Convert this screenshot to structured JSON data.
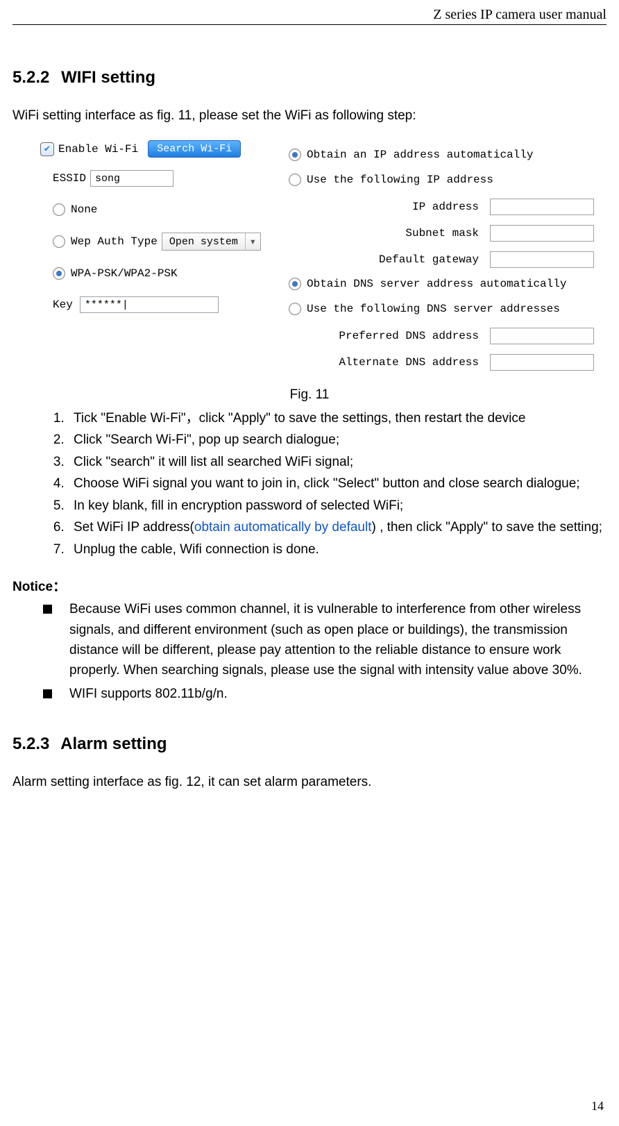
{
  "header": {
    "title": "Z series IP camera user manual"
  },
  "page_number": "14",
  "section1": {
    "number": "5.2.2",
    "title": "WIFI setting",
    "intro": "WiFi setting interface as fig. 11, please set the WiFi as following step:"
  },
  "wifi_panel": {
    "enable_label": "Enable Wi-Fi",
    "search_btn": "Search Wi-Fi",
    "essid_label": "ESSID",
    "essid_value": "song",
    "auth_none": "None",
    "auth_wep": "Wep Auth Type",
    "wep_select_value": "Open system",
    "auth_wpa": "WPA-PSK/WPA2-PSK",
    "key_label": "Key",
    "key_value": "******|",
    "ip_auto": "Obtain an IP address automatically",
    "ip_manual": "Use the following IP address",
    "ip_addr_label": "IP address",
    "subnet_label": "Subnet mask",
    "gateway_label": "Default gateway",
    "dns_auto": "Obtain DNS server address automatically",
    "dns_manual": "Use the following DNS server addresses",
    "dns_pref_label": "Preferred DNS address",
    "dns_alt_label": "Alternate DNS address"
  },
  "fig_caption": "Fig. 11",
  "steps": {
    "s1a": "Tick \"Enable Wi-Fi\"，click \"Apply\" to save the settings, then restart the device",
    "s2": "Click \"Search Wi-Fi\", pop up search dialogue;",
    "s3": "Click \"search\" it will list all searched WiFi signal;",
    "s4": "Choose WiFi signal you want to join in, click \"Select\" button and close search dialogue;",
    "s5": "In key blank, fill in encryption password of selected WiFi;",
    "s6a": "Set WiFi IP address(",
    "s6link": "obtain automatically by default",
    "s6b": ") , then click \"Apply\" to save the setting;",
    "s7": "Unplug the cable, Wifi connection is done."
  },
  "notice_heading": "Notice：",
  "notice": {
    "n1": "Because WiFi uses common channel, it is vulnerable to interference from other wireless signals, and different environment (such as open place or buildings), the transmission distance will be different, please pay attention to the reliable distance to ensure work properly. When searching signals, please use the signal with intensity value above 30%.",
    "n2": "WIFI supports 802.11b/g/n."
  },
  "section2": {
    "number": "5.2.3",
    "title": "Alarm setting",
    "intro": "Alarm setting interface as fig. 12, it can set alarm parameters."
  }
}
